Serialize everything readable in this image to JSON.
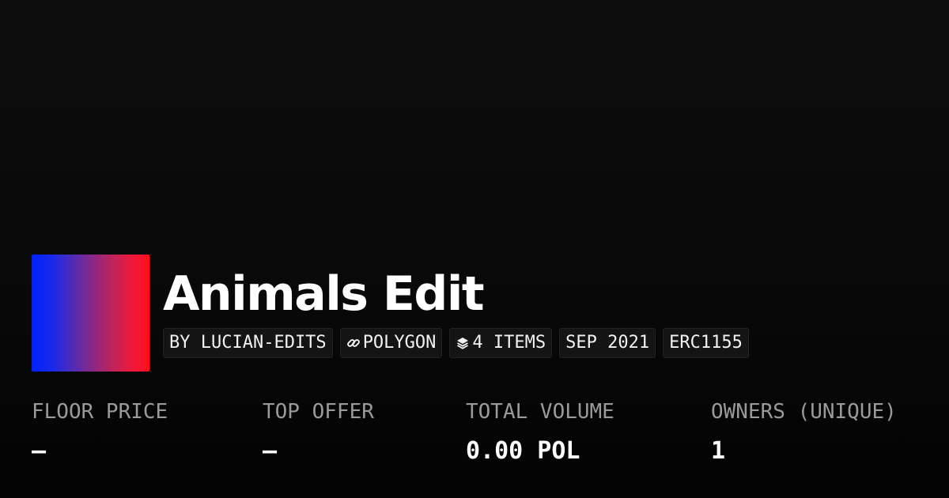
{
  "collection": {
    "title": "Animals Edit",
    "avatar_gradient": [
      "#0022ff",
      "#ff0f1a"
    ]
  },
  "tags": {
    "creator": "BY LUCIAN-EDITS",
    "chain": "POLYGON",
    "chain_icon": "link-icon",
    "items": "4 ITEMS",
    "items_icon": "layers-icon",
    "date": "SEP 2021",
    "standard": "ERC1155"
  },
  "stats": {
    "floor_price": {
      "label": "FLOOR PRICE",
      "value": "–"
    },
    "top_offer": {
      "label": "TOP OFFER",
      "value": "–"
    },
    "total_volume": {
      "label": "TOTAL VOLUME",
      "value": "0.00 POL"
    },
    "owners": {
      "label": "OWNERS (UNIQUE)",
      "value": "1"
    }
  }
}
